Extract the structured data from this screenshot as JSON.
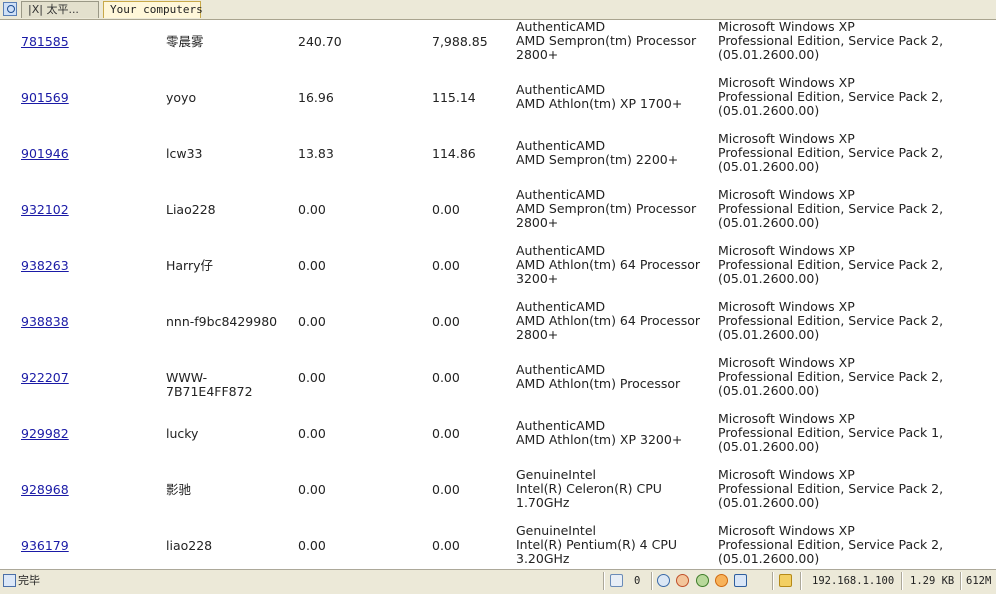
{
  "tabs": [
    {
      "label": "|X| 太平..."
    },
    {
      "label": "Your computers"
    }
  ],
  "rows": [
    {
      "id": "781585",
      "name": "零晨雾",
      "value1": "240.70",
      "value2": "7,988.85",
      "cpu": [
        "AuthenticAMD",
        "AMD Sempron(tm) Processor",
        "2800+"
      ],
      "os": [
        "Microsoft Windows XP",
        "Professional Edition, Service Pack 2,",
        "(05.01.2600.00)"
      ]
    },
    {
      "id": "901569",
      "name": "yoyo",
      "value1": "16.96",
      "value2": "115.14",
      "cpu": [
        "AuthenticAMD",
        "AMD Athlon(tm) XP 1700+"
      ],
      "os": [
        "Microsoft Windows XP",
        "Professional Edition, Service Pack 2,",
        "(05.01.2600.00)"
      ]
    },
    {
      "id": "901946",
      "name": "lcw33",
      "value1": "13.83",
      "value2": "114.86",
      "cpu": [
        "AuthenticAMD",
        "AMD Sempron(tm) 2200+"
      ],
      "os": [
        "Microsoft Windows XP",
        "Professional Edition, Service Pack 2,",
        "(05.01.2600.00)"
      ]
    },
    {
      "id": "932102",
      "name": "Liao228",
      "value1": "0.00",
      "value2": "0.00",
      "cpu": [
        "AuthenticAMD",
        "AMD Sempron(tm) Processor",
        "2800+"
      ],
      "os": [
        "Microsoft Windows XP",
        "Professional Edition, Service Pack 2,",
        "(05.01.2600.00)"
      ]
    },
    {
      "id": "938263",
      "name": "Harry仔",
      "value1": "0.00",
      "value2": "0.00",
      "cpu": [
        "AuthenticAMD",
        "AMD Athlon(tm) 64 Processor",
        "3200+"
      ],
      "os": [
        "Microsoft Windows XP",
        "Professional Edition, Service Pack 2,",
        "(05.01.2600.00)"
      ]
    },
    {
      "id": "938838",
      "name": "nnn-f9bc8429980",
      "value1": "0.00",
      "value2": "0.00",
      "cpu": [
        "AuthenticAMD",
        "AMD Athlon(tm) 64 Processor",
        "2800+"
      ],
      "os": [
        "Microsoft Windows XP",
        "Professional Edition, Service Pack 2,",
        "(05.01.2600.00)"
      ]
    },
    {
      "id": "922207",
      "name": "WWW-7B71E4FF872",
      "value1": "0.00",
      "value2": "0.00",
      "cpu": [
        "AuthenticAMD",
        "AMD Athlon(tm) Processor"
      ],
      "os": [
        "Microsoft Windows XP",
        "Professional Edition, Service Pack 2,",
        "(05.01.2600.00)"
      ]
    },
    {
      "id": "929982",
      "name": "lucky",
      "value1": "0.00",
      "value2": "0.00",
      "cpu": [
        "AuthenticAMD",
        "AMD Athlon(tm) XP 3200+"
      ],
      "os": [
        "Microsoft Windows XP",
        "Professional Edition, Service Pack 1,",
        "(05.01.2600.00)"
      ]
    },
    {
      "id": "928968",
      "name": "影驰",
      "value1": "0.00",
      "value2": "0.00",
      "cpu": [
        "GenuineIntel",
        "Intel(R) Celeron(R) CPU",
        "1.70GHz"
      ],
      "os": [
        "Microsoft Windows XP",
        "Professional Edition, Service Pack 2,",
        "(05.01.2600.00)"
      ]
    },
    {
      "id": "936179",
      "name": "liao228",
      "value1": "0.00",
      "value2": "0.00",
      "cpu": [
        "GenuineIntel",
        "Intel(R) Pentium(R) 4 CPU",
        "3.20GHz"
      ],
      "os": [
        "Microsoft Windows XP",
        "Professional Edition, Service Pack 2,",
        "(05.01.2600.00)"
      ]
    }
  ],
  "status": {
    "text": "完毕",
    "count": "0",
    "ip": "192.168.1.100",
    "speed": "1.29 KB",
    "memory": "612M"
  },
  "status_icons": [
    "page-icon",
    "trash-icon",
    "network-icon",
    "block-icon",
    "refresh-icon",
    "gear-icon",
    "window-icon",
    "folder-icon"
  ]
}
